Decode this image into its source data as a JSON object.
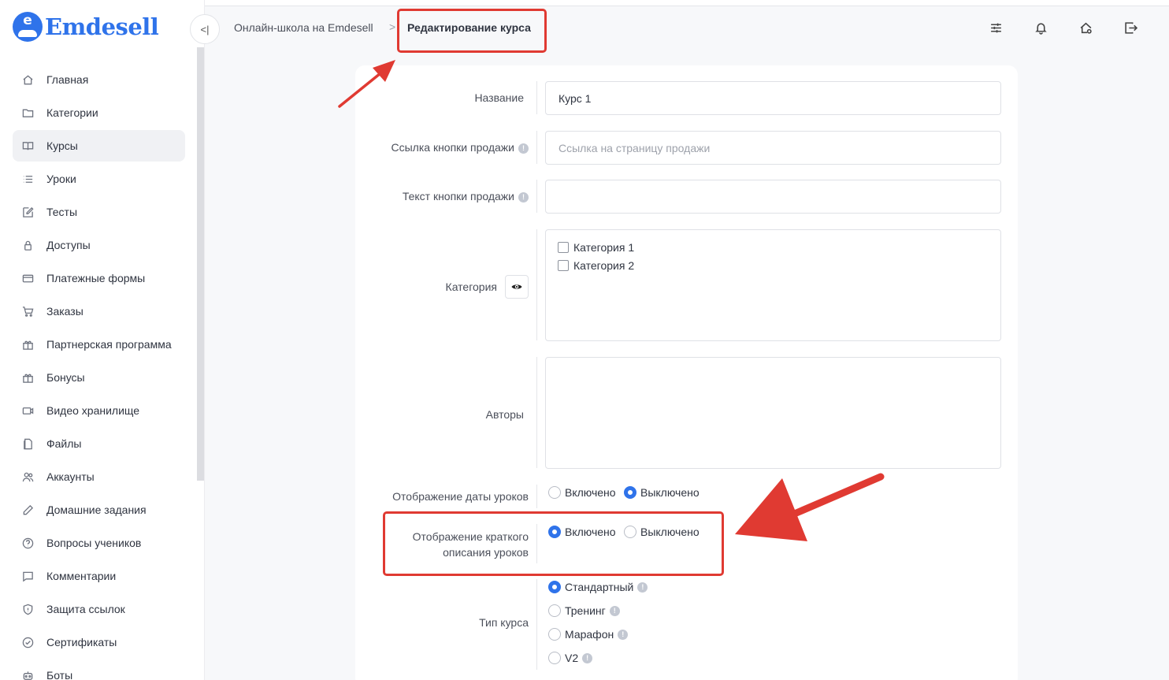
{
  "app": {
    "logo_text": "Emdesell",
    "logo_letter": "e"
  },
  "sidebar": {
    "items": [
      {
        "label": "Главная",
        "icon": "home-icon"
      },
      {
        "label": "Категории",
        "icon": "folder-icon"
      },
      {
        "label": "Курсы",
        "icon": "book-icon",
        "active": true
      },
      {
        "label": "Уроки",
        "icon": "list-icon"
      },
      {
        "label": "Тесты",
        "icon": "edit-icon"
      },
      {
        "label": "Доступы",
        "icon": "lock-icon"
      },
      {
        "label": "Платежные формы",
        "icon": "credit-card-icon"
      },
      {
        "label": "Заказы",
        "icon": "cart-icon"
      },
      {
        "label": "Партнерская программа",
        "icon": "gift-icon"
      },
      {
        "label": "Бонусы",
        "icon": "gift-icon"
      },
      {
        "label": "Видео хранилище",
        "icon": "video-icon"
      },
      {
        "label": "Файлы",
        "icon": "file-icon"
      },
      {
        "label": "Аккаунты",
        "icon": "users-icon"
      },
      {
        "label": "Домашние задания",
        "icon": "pencil-icon"
      },
      {
        "label": "Вопросы учеников",
        "icon": "question-icon"
      },
      {
        "label": "Комментарии",
        "icon": "comment-icon"
      },
      {
        "label": "Защита ссылок",
        "icon": "shield-icon"
      },
      {
        "label": "Сертификаты",
        "icon": "check-circle-icon"
      },
      {
        "label": "Боты",
        "icon": "bot-icon"
      }
    ]
  },
  "header": {
    "breadcrumb_parent": "Онлайн-школа на Emdesell",
    "breadcrumb_separator": ">",
    "breadcrumb_current": "Редактирование курса",
    "collapse_symbol": "<|"
  },
  "form": {
    "name_label": "Название",
    "name_value": "Курс 1",
    "sale_link_label": "Ссылка кнопки продажи",
    "sale_link_placeholder": "Ссылка на страницу продажи",
    "sale_text_label": "Текст кнопки продажи",
    "sale_text_value": "",
    "category_label": "Категория",
    "categories": [
      "Категория 1",
      "Категория 2"
    ],
    "authors_label": "Авторы",
    "date_display_label": "Отображение даты уроков",
    "short_desc_label_line1": "Отображение краткого",
    "short_desc_label_line2": "описания уроков",
    "on_label": "Включено",
    "off_label": "Выключено",
    "date_display_selected": "Выключено",
    "short_desc_selected": "Включено",
    "course_type_label": "Тип курса",
    "course_types": [
      "Стандартный",
      "Тренинг",
      "Марафон",
      "V2"
    ],
    "course_type_selected": "Стандартный"
  },
  "colors": {
    "accent": "#2f73ea",
    "annotation_red": "#e03a32"
  }
}
